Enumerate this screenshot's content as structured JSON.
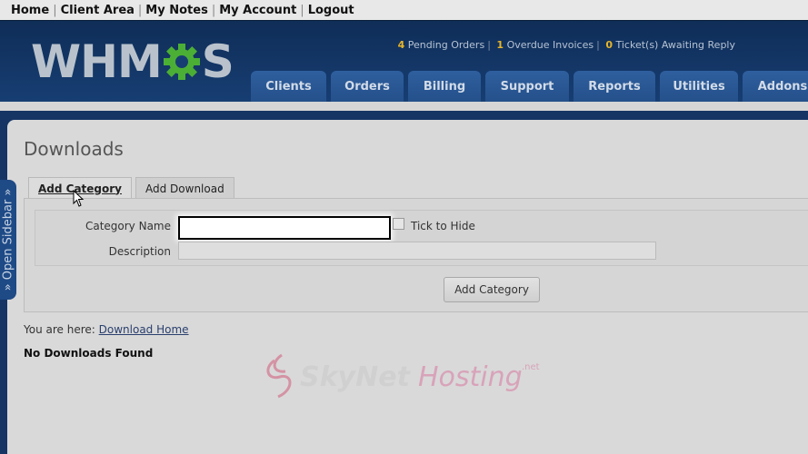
{
  "toplinks": [
    "Home",
    "Client Area",
    "My Notes",
    "My Account",
    "Logout"
  ],
  "logo": {
    "left": "WHM",
    "right": "S"
  },
  "status": {
    "pending_num": "4",
    "pending_text": "Pending Orders",
    "overdue_num": "1",
    "overdue_text": "Overdue Invoices",
    "tickets_num": "0",
    "tickets_text": "Ticket(s) Awaiting Reply"
  },
  "nav_tabs": [
    "Clients",
    "Orders",
    "Billing",
    "Support",
    "Reports",
    "Utilities",
    "Addons"
  ],
  "sidebar_label": "» Open Sidebar »",
  "page_title": "Downloads",
  "subtabs": [
    "Add Category",
    "Add Download"
  ],
  "form": {
    "category_label": "Category Name",
    "category_value": "",
    "hide_label": "Tick to Hide",
    "description_label": "Description",
    "description_value": "",
    "submit_label": "Add Category"
  },
  "breadcrumb": {
    "prefix": "You are here:",
    "link": "Download Home"
  },
  "empty_message": "No Downloads Found",
  "watermark": {
    "left": "SkyNet",
    "right": "Hosting",
    "tld": ".net"
  },
  "colors": {
    "header": "#173e73",
    "tab": "#2f5f9e",
    "accent": "#e7b528",
    "logo_gear": "#4caf35"
  }
}
